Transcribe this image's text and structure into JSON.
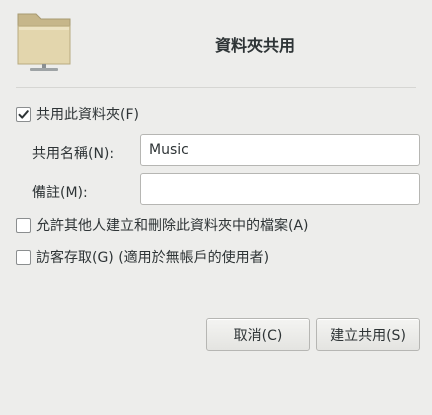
{
  "dialog": {
    "title": "資料夾共用",
    "share_folder_label": "共用此資料夾(F)",
    "share_folder_checked": true,
    "share_name_label": "共用名稱(N):",
    "share_name_value": "Music",
    "comment_label": "備註(M):",
    "comment_value": "",
    "allow_others_label": "允許其他人建立和刪除此資料夾中的檔案(A)",
    "allow_others_checked": false,
    "guest_access_label": "訪客存取(G) (適用於無帳戶的使用者)",
    "guest_access_checked": false,
    "cancel_label": "取消(C)",
    "create_label": "建立共用(S)"
  },
  "icons": {
    "header_icon": "folder-icon",
    "check_icon": "checkmark-icon"
  },
  "colors": {
    "background": "#ededeb",
    "folder_body": "#e3d6ad",
    "folder_tab": "#c6b68a"
  }
}
